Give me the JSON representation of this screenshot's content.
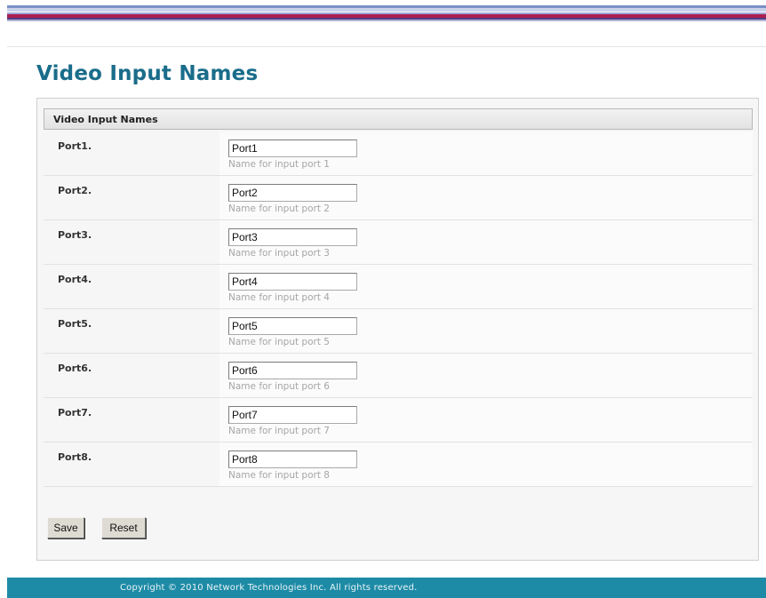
{
  "page": {
    "title": "Video Input Names"
  },
  "panel": {
    "header": "Video Input Names",
    "rows": [
      {
        "label": "Port1.",
        "value": "Port1",
        "hint": "Name for input port 1"
      },
      {
        "label": "Port2.",
        "value": "Port2",
        "hint": "Name for input port 2"
      },
      {
        "label": "Port3.",
        "value": "Port3",
        "hint": "Name for input port 3"
      },
      {
        "label": "Port4.",
        "value": "Port4",
        "hint": "Name for input port 4"
      },
      {
        "label": "Port5.",
        "value": "Port5",
        "hint": "Name for input port 5"
      },
      {
        "label": "Port6.",
        "value": "Port6",
        "hint": "Name for input port 6"
      },
      {
        "label": "Port7.",
        "value": "Port7",
        "hint": "Name for input port 7"
      },
      {
        "label": "Port8.",
        "value": "Port8",
        "hint": "Name for input port 8"
      }
    ]
  },
  "buttons": {
    "save": "Save",
    "reset": "Reset"
  },
  "footer": {
    "copyright": "Copyright © 2010 Network Technologies Inc. All rights reserved."
  },
  "colors": {
    "title": "#1a6d8a",
    "footer_bg": "#1e8ba6",
    "stripe_red": "#ad1f4f",
    "stripe_blue": "#7b8fc7"
  }
}
